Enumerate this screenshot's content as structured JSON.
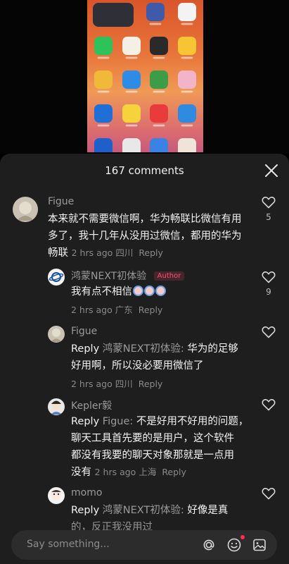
{
  "sheet": {
    "title": "167 comments"
  },
  "comments": [
    {
      "name": "Figue",
      "text": "本来就不需要微信啊，华为畅联比微信有用多了，我十几年从没用过微信，都用的华为畅联",
      "line1": "本来就不需要微信啊，华为畅联比微信有用",
      "line2": "多了，我十几年从没用过微信，都用的华为",
      "line3": "畅联",
      "time": "2 hrs ago",
      "location": "四川",
      "reply_label": "Reply",
      "likes": "5"
    },
    {
      "name": "鸿蒙NEXT初体验",
      "badge": "Author",
      "text": "我有点不相信",
      "time": "2 hrs ago",
      "location": "广东",
      "reply_label": "Reply",
      "likes": "9"
    },
    {
      "name": "Figue",
      "reply_prefix": "Reply",
      "reply_to": "鸿蒙NEXT初体验:",
      "line1": "华为的足够",
      "line2": "好用啊，所以没必要用微信了",
      "time": "2 hrs ago",
      "location": "四川",
      "reply_label": "Reply"
    },
    {
      "name": "Kepler毅",
      "reply_prefix": "Reply",
      "reply_to": "Figue:",
      "line1": "不是好用不好用的问题，",
      "line2": "聊天工具首先要的是用户，这个软件",
      "line3": "都没有我要的聊天对象那就是一点用",
      "line4": "没有",
      "time": "2 hrs ago",
      "location": "上海",
      "reply_label": "Reply"
    },
    {
      "name": "momo",
      "reply_prefix": "Reply",
      "reply_to": "鸿蒙NEXT初体验:",
      "line1": "好像是真",
      "line2": "的，反正我没用过"
    }
  ],
  "input": {
    "placeholder": "Say something..."
  },
  "icons": {
    "close": "close-icon",
    "like": "heart-icon",
    "mention": "at-icon",
    "emoji": "emoji-icon",
    "image": "image-icon"
  },
  "colors": {
    "sheet_bg": "#1e1e1e",
    "author_badge": "#ff4d73",
    "notification_dot": "#ff2d55"
  }
}
